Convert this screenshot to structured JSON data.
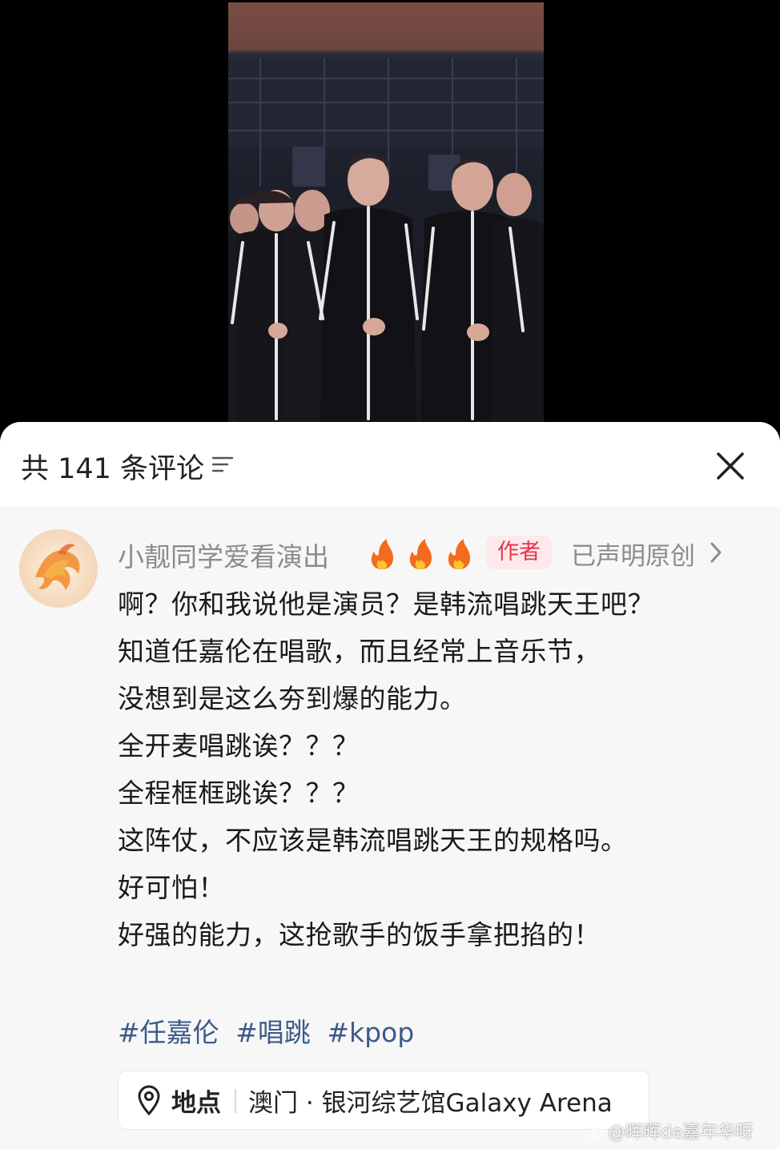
{
  "header": {
    "comment_count_label": "共 141 条评论"
  },
  "comment": {
    "username": "小靓同学爱看演出",
    "author_badge": "作者",
    "original_label": "已声明原创",
    "lines": [
      "啊？你和我说他是演员？是韩流唱跳天王吧？",
      "知道任嘉伦在唱歌，而且经常上音乐节，",
      "没想到是这么夯到爆的能力。",
      "全开麦唱跳诶？？？",
      "全程框框跳诶？？？",
      "这阵仗，不应该是韩流唱跳天王的规格吗。",
      "好可怕！",
      "好强的能力，这抢歌手的饭手拿把掐的！"
    ],
    "hashtags": [
      "#任嘉伦",
      "#唱跳",
      "#kpop"
    ],
    "location": {
      "label": "地点",
      "value": "澳门 · 银河综艺馆Galaxy Arena"
    }
  },
  "watermark": "@晖晖de嘉年华呀",
  "colors": {
    "author_badge_bg": "#fde9ec",
    "author_badge_text": "#e8334b",
    "hashtag": "#3d5a8a",
    "sheet_bg": "#f7f7f7"
  },
  "icons": [
    "filter-icon",
    "close-icon",
    "fire-icon",
    "chevron-right-icon",
    "location-pin-icon",
    "weibo-icon"
  ]
}
